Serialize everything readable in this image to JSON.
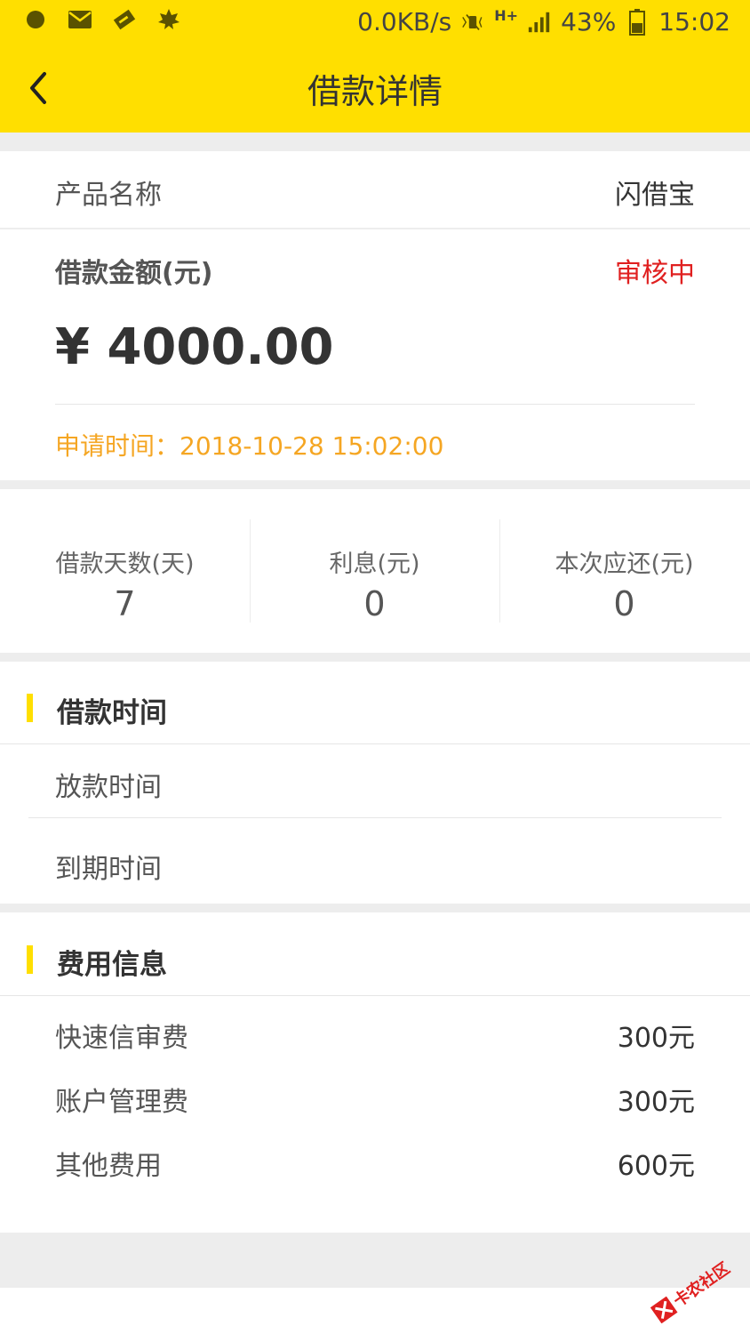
{
  "status_bar": {
    "speed": "0.0KB/s",
    "network": "H+",
    "battery": "43%",
    "time": "15:02",
    "icons": [
      "notification-dot-icon",
      "mail-icon",
      "wallet-icon",
      "leaf-icon",
      "mute-icon",
      "signal-icon",
      "battery-icon"
    ]
  },
  "nav": {
    "title": "借款详情"
  },
  "product": {
    "label": "产品名称",
    "value": "闪借宝"
  },
  "loan": {
    "amount_label": "借款金额(元)",
    "status": "审核中",
    "amount": "¥ 4000.00",
    "apply_time": "申请时间：2018-10-28 15:02:00"
  },
  "stats": [
    {
      "label": "借款天数(天)",
      "value": "7"
    },
    {
      "label": "利息(元)",
      "value": "0"
    },
    {
      "label": "本次应还(元)",
      "value": "0"
    }
  ],
  "loan_time": {
    "title": "借款时间",
    "rows": [
      {
        "label": "放款时间",
        "value": ""
      },
      {
        "label": "到期时间",
        "value": ""
      }
    ]
  },
  "fees": {
    "title": "费用信息",
    "rows": [
      {
        "label": "快速信审费",
        "value": "300元"
      },
      {
        "label": "账户管理费",
        "value": "300元"
      },
      {
        "label": "其他费用",
        "value": "600元"
      }
    ]
  },
  "watermark": "卡农社区",
  "colors": {
    "accent": "#ffdf00",
    "status_red": "#e02020",
    "apply_orange": "#f5a623"
  }
}
